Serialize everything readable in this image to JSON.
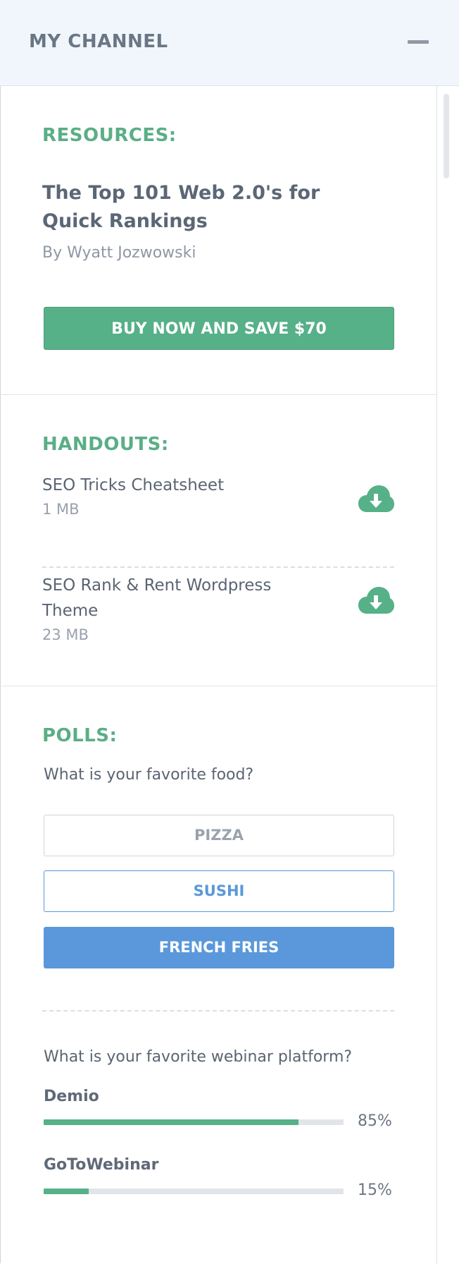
{
  "header": {
    "title": "MY CHANNEL"
  },
  "resources": {
    "heading": "RESOURCES:",
    "book_title": "The Top 101 Web 2.0's for Quick Rankings",
    "author": "By Wyatt Jozwowski",
    "buy_label": "BUY NOW AND SAVE $70"
  },
  "handouts": {
    "heading": "HANDOUTS:",
    "items": [
      {
        "name": "SEO Tricks Cheatsheet",
        "size": "1 MB",
        "icon": "cloud-download-icon"
      },
      {
        "name": "SEO Rank & Rent Wordpress Theme",
        "size": "23 MB",
        "icon": "cloud-download-icon"
      }
    ]
  },
  "polls": {
    "heading": "POLLS:",
    "question1": "What is your favorite food?",
    "options": [
      "PIZZA",
      "SUSHI",
      "FRENCH FRIES"
    ],
    "question2": "What is your favorite webinar platform?",
    "results": [
      {
        "label": "Demio",
        "percent": 85,
        "percent_text": "85%"
      },
      {
        "label": "GoToWebinar",
        "percent": 15,
        "percent_text": "15%"
      }
    ]
  },
  "colors": {
    "accent_green": "#56b088",
    "accent_blue": "#5a98db"
  }
}
